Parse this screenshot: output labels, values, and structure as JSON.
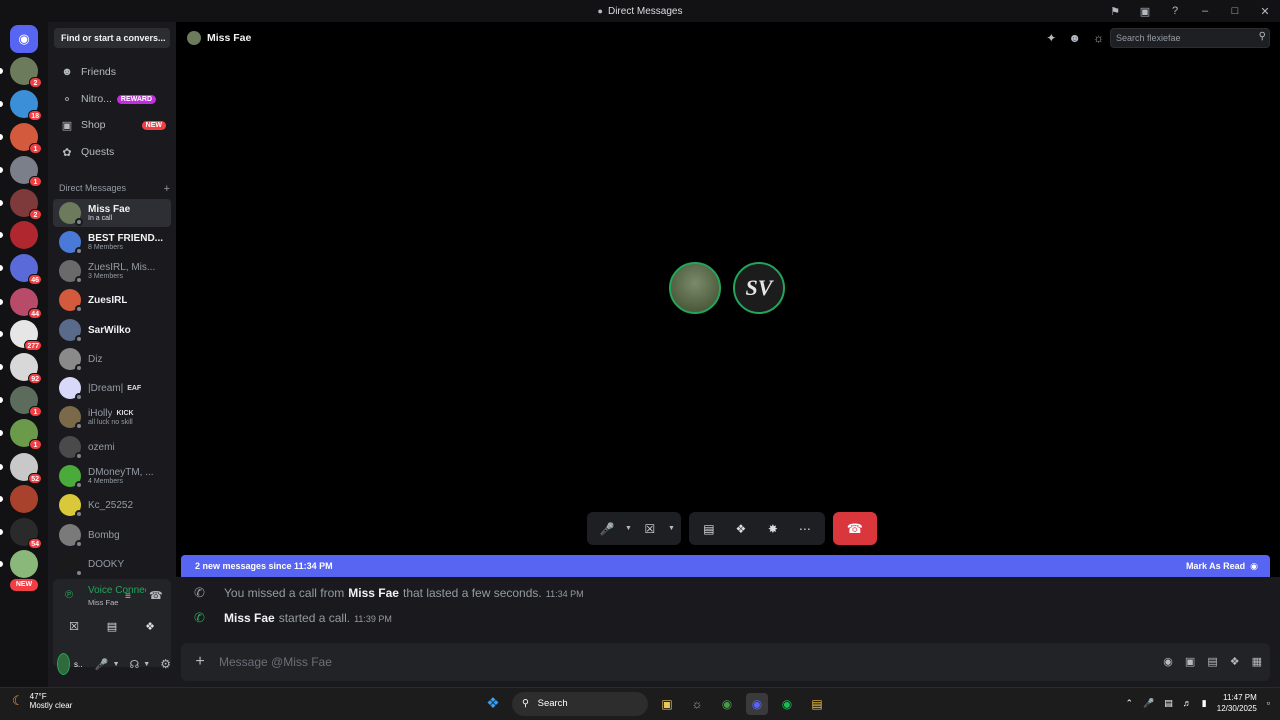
{
  "window": {
    "title": "Direct Messages"
  },
  "rail": {
    "servers": [
      {
        "badge": "2",
        "color": "#6b7b5c"
      },
      {
        "badge": "18",
        "color": "#3a8fd8"
      },
      {
        "badge": "1",
        "color": "#d35a3c"
      },
      {
        "badge": "1",
        "color": "#7b7f8a"
      },
      {
        "badge": "2",
        "color": "#7e3a3a"
      },
      {
        "badge": "",
        "color": "#b0272f"
      },
      {
        "badge": "46",
        "color": "#5a6ad8"
      },
      {
        "badge": "44",
        "color": "#b84a6a"
      },
      {
        "badge": "277",
        "color": "#e6e6e6"
      },
      {
        "badge": "92",
        "color": "#d8d8d8"
      },
      {
        "badge": "1",
        "color": "#5c6c5c"
      },
      {
        "badge": "1",
        "color": "#6a9a4a"
      },
      {
        "badge": "52",
        "color": "#c8c8c8"
      },
      {
        "badge": "",
        "color": "#a8422c"
      },
      {
        "badge": "54",
        "color": "#2a2a2a"
      },
      {
        "badge": "",
        "color": "#8ab87a"
      }
    ],
    "new_label": "NEW"
  },
  "sidebar": {
    "find_placeholder": "Find or start a convers...",
    "nav": [
      {
        "label": "Friends",
        "icon": "friends-icon"
      },
      {
        "label": "Nitro...",
        "tag": "REWARD",
        "icon": "nitro-icon"
      },
      {
        "label": "Shop",
        "tag": "NEW",
        "icon": "shop-icon"
      },
      {
        "label": "Quests",
        "icon": "quests-icon"
      }
    ],
    "dm_header": "Direct Messages",
    "dms": [
      {
        "name": "Miss Fae",
        "sub": "In a call",
        "color": "#6b7b5c"
      },
      {
        "name": "BEST FRIEND...",
        "sub": "8 Members",
        "color": "#4a7ad8"
      },
      {
        "name": "ZuesIRL, Mis...",
        "sub": "3 Members",
        "color": "#6a6a6a"
      },
      {
        "name": "ZuesIRL",
        "sub": "",
        "color": "#d35a3c"
      },
      {
        "name": "SarWilko",
        "sub": "",
        "color": "#5a6a8a"
      },
      {
        "name": "Diz",
        "sub": "",
        "color": "#8a8a8a"
      },
      {
        "name": "|Dream|",
        "tag": "EAF",
        "sub": "",
        "color": "#d8d8f8"
      },
      {
        "name": "iHolly",
        "tag": "KICK",
        "sub": "all luck no skill",
        "color": "#7a6a4a"
      },
      {
        "name": "ozemi",
        "sub": "",
        "color": "#4a4a4a"
      },
      {
        "name": "DMoneyTM, ...",
        "sub": "4 Members",
        "color": "#4aaa3a"
      },
      {
        "name": "Kc_25252",
        "sub": "",
        "color": "#d8c83a"
      },
      {
        "name": "Bombg",
        "sub": "",
        "color": "#7a7a7a"
      },
      {
        "name": "DOOKY",
        "sub": "",
        "color": "#1a1a1a"
      }
    ],
    "voice": {
      "status": "Voice Connected",
      "channel": "Miss Fae"
    },
    "user": {
      "name": "s..."
    }
  },
  "header": {
    "name": "Miss Fae",
    "search_placeholder": "Search flexiefae"
  },
  "call": {
    "participants": [
      {
        "label": "",
        "color": "#4f5a3c"
      },
      {
        "label": "SV",
        "color": "#1c1c1c"
      }
    ]
  },
  "banner": {
    "text": "2 new messages since 11:34 PM",
    "action": "Mark As Read"
  },
  "messages": [
    {
      "prefix": "You missed a call from",
      "name": "Miss Fae",
      "suffix": "that lasted a few seconds.",
      "time": "11:34 PM",
      "icon_color": "#949ba4"
    },
    {
      "prefix": "",
      "name": "Miss Fae",
      "suffix": "started a call.",
      "time": "11:39 PM",
      "icon_color": "#23a55a"
    }
  ],
  "composer": {
    "placeholder": "Message @Miss Fae"
  },
  "taskbar": {
    "temp": "47°F",
    "condition": "Mostly clear",
    "search": "Search",
    "time": "11:47 PM",
    "date": "12/30/2025"
  }
}
